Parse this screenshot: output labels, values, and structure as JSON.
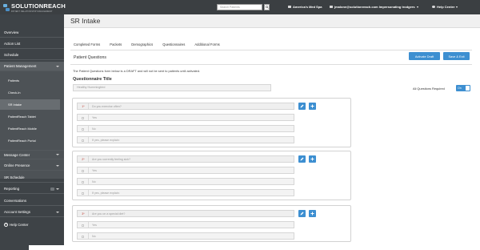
{
  "brand": {
    "name": "SOLUTIONREACH",
    "tagline": "PATIENT RELATIONSHIP MANAGEMENT"
  },
  "topbar": {
    "search_placeholder": "Search Patients",
    "location": "America's Med Spa",
    "user": "jmalone@solutionreach.com Impersonating trodgers",
    "help": "Help Center"
  },
  "sidebar": {
    "items": [
      {
        "label": "Overview"
      },
      {
        "label": "Action List"
      },
      {
        "label": "Schedule"
      },
      {
        "label": "Patient Management"
      }
    ],
    "sub_items": [
      {
        "label": "Patients"
      },
      {
        "label": "Check-In"
      },
      {
        "label": "SR Intake"
      },
      {
        "label": "PatientReach Tablet"
      },
      {
        "label": "PatientReach Mobile"
      },
      {
        "label": "PatientReach Portal"
      }
    ],
    "lower_items": [
      {
        "label": "Message Center"
      },
      {
        "label": "Online Presence"
      },
      {
        "label": "SR Schedule"
      },
      {
        "label": "Reporting"
      },
      {
        "label": "Conversations"
      },
      {
        "label": "Account Settings"
      },
      {
        "label": "Help Center"
      }
    ]
  },
  "page": {
    "title": "SR Intake"
  },
  "tabs": [
    {
      "label": "Completed Forms"
    },
    {
      "label": "Packets"
    },
    {
      "label": "Demographics"
    },
    {
      "label": "Questionnaires"
    },
    {
      "label": "Additional Forms"
    }
  ],
  "section": {
    "title": "Patient Questions",
    "activate_label": "Activate Draft",
    "save_label": "Save & Exit",
    "draft_note": "The Patient Questions form below is a DRAFT and will not be sent to patients until activated.",
    "questionnaire_title_label": "Questionnaire Title",
    "questionnaire_title_value": "Healthy Hummingbird",
    "all_required_label": "All Questions Required",
    "toggle_label": "On"
  },
  "questions": [
    {
      "number": "1*",
      "prompt": "Do you exercise often?",
      "options": [
        "Yes",
        "No",
        "If yes, please explain:"
      ]
    },
    {
      "number": "2*",
      "prompt": "Are you currently feeling sick?",
      "options": [
        "Yes",
        "No",
        "If yes, please explain:"
      ]
    },
    {
      "number": "3*",
      "prompt": "Are you on a special diet?",
      "options": [
        "Yes",
        "No"
      ]
    }
  ],
  "colors": {
    "accent": "#3d8fd1",
    "sidebar": "#3e4347",
    "topbar": "#3b3f42",
    "required": "#c0392b"
  }
}
